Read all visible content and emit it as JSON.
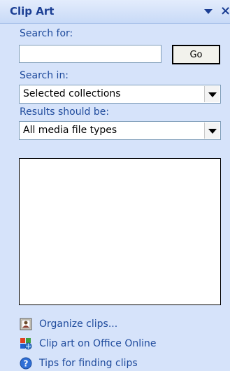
{
  "pane": {
    "title": "Clip Art",
    "close_glyph": "×"
  },
  "search": {
    "label": "Search for:",
    "value": "",
    "placeholder": "",
    "go_label": "Go"
  },
  "search_in": {
    "label": "Search in:",
    "selected": "Selected collections"
  },
  "results_type": {
    "label": "Results should be:",
    "selected": "All media file types"
  },
  "links": [
    {
      "label": "Organize clips...",
      "icon": "organize-clips-icon"
    },
    {
      "label": "Clip art on Office Online",
      "icon": "office-online-icon"
    },
    {
      "label": "Tips for finding clips",
      "icon": "help-icon"
    }
  ],
  "colors": {
    "title": "#1c3f94",
    "link": "#1e4a9c",
    "pane_bg": "#d6e3fa"
  }
}
